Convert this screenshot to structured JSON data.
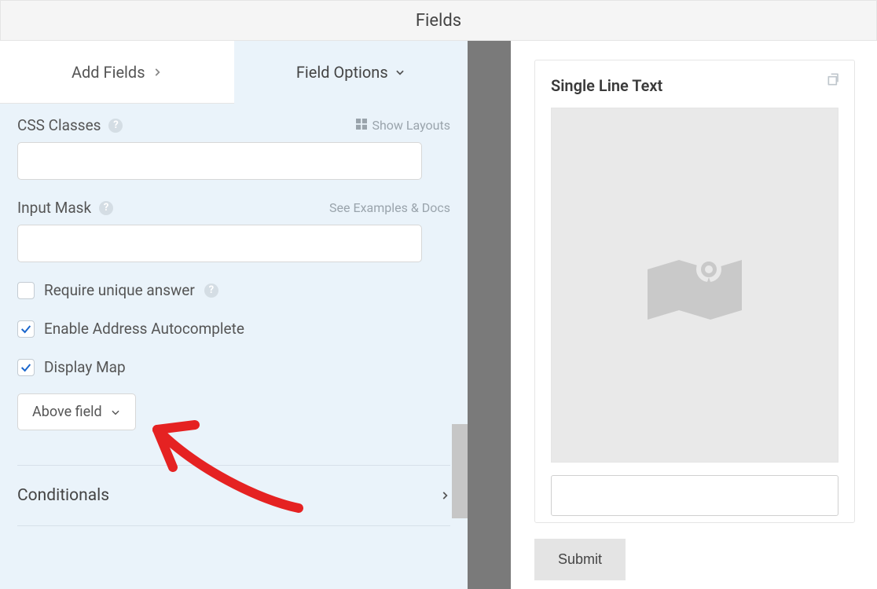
{
  "header": {
    "title": "Fields"
  },
  "tabs": {
    "add_fields": "Add Fields",
    "field_options": "Field Options"
  },
  "options": {
    "css_classes": {
      "label": "CSS Classes",
      "show_layouts": "Show Layouts",
      "value": ""
    },
    "input_mask": {
      "label": "Input Mask",
      "examples": "See Examples & Docs",
      "value": ""
    },
    "require_unique": {
      "label": "Require unique answer",
      "checked": false
    },
    "autocomplete": {
      "label": "Enable Address Autocomplete",
      "checked": true
    },
    "display_map": {
      "label": "Display Map",
      "checked": true,
      "position": "Above field"
    },
    "conditionals": {
      "label": "Conditionals"
    }
  },
  "preview": {
    "field_title": "Single Line Text",
    "input_value": "",
    "submit": "Submit"
  }
}
